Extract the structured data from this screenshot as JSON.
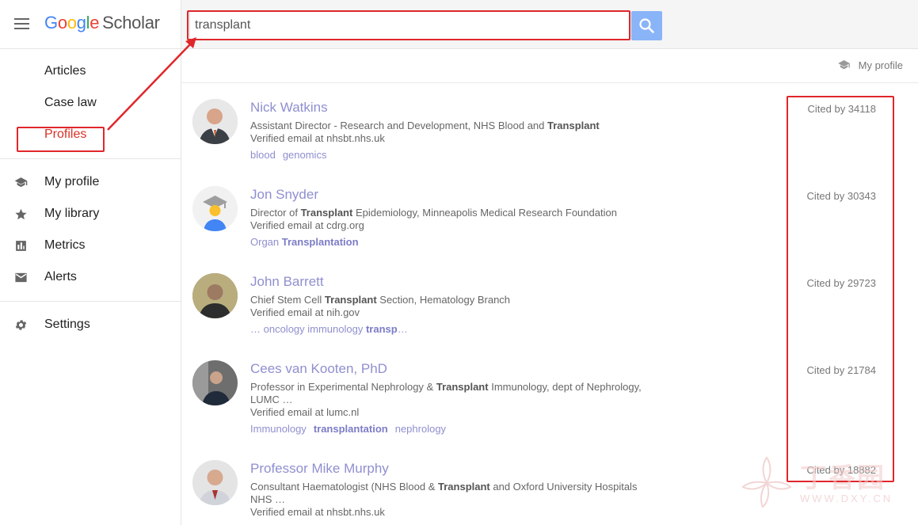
{
  "logo": {
    "g": [
      "G",
      "o",
      "o",
      "g",
      "l",
      "e"
    ],
    "scholar": "Scholar"
  },
  "search": {
    "value": "transplant",
    "placeholder": ""
  },
  "sidebar": {
    "group1": [
      {
        "label": "Articles"
      },
      {
        "label": "Case law"
      },
      {
        "label": "Profiles"
      }
    ],
    "group2": [
      {
        "label": "My profile",
        "icon": "graduation-cap-icon"
      },
      {
        "label": "My library",
        "icon": "star-icon"
      },
      {
        "label": "Metrics",
        "icon": "metrics-icon"
      },
      {
        "label": "Alerts",
        "icon": "envelope-icon"
      }
    ],
    "group3": [
      {
        "label": "Settings",
        "icon": "gear-icon"
      }
    ]
  },
  "subheader": {
    "my_profile": "My profile"
  },
  "results": [
    {
      "name": "Nick Watkins",
      "affiliation": "Assistant Director - Research and Development, NHS Blood and Transplant",
      "email": "Verified email at nhsbt.nhs.uk",
      "tags": [
        "blood",
        "genomics"
      ],
      "cited": "Cited by 34118"
    },
    {
      "name": "Jon Snyder",
      "affiliation": "Director of Transplant Epidemiology, Minneapolis Medical Research Foundation",
      "email": "Verified email at cdrg.org",
      "tags": [
        "Organ Transplantation"
      ],
      "cited": "Cited by 30343"
    },
    {
      "name": "John Barrett",
      "affiliation": "Chief Stem Cell Transplant Section, Hematology Branch",
      "email": "Verified email at nih.gov",
      "tags": [
        "… oncology immunology transp…"
      ],
      "cited": "Cited by 29723"
    },
    {
      "name": "Cees van Kooten, PhD",
      "affiliation": "Professor in Experimental Nephrology & Transplant Immunology, dept of Nephrology, LUMC …",
      "email": "Verified email at lumc.nl",
      "tags": [
        "Immunology",
        "transplantation",
        "nephrology"
      ],
      "cited": "Cited by 21784"
    },
    {
      "name": "Professor Mike Murphy",
      "affiliation": "Consultant Haematologist (NHS Blood & Transplant and Oxford University Hospitals NHS …",
      "email": "Verified email at nhsbt.nhs.uk",
      "tags": [],
      "cited": "Cited by 18882"
    }
  ],
  "watermark": {
    "text": "丁香园",
    "url": "WWW.DXY.CN"
  },
  "colors": {
    "link": "#8f8fd0",
    "highlight": "#e0262b",
    "search_button": "#8ab4f8",
    "active_nav": "#d93025"
  }
}
